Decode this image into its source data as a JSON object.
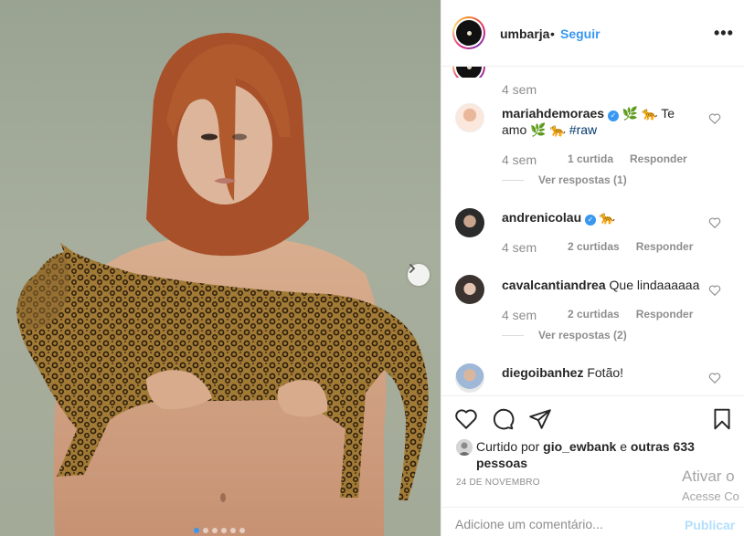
{
  "post": {
    "username": "umbarja",
    "separator": "•",
    "follow_label": "Seguir",
    "more_label": "•••",
    "carousel": {
      "total": 6,
      "active": 0
    }
  },
  "comments": {
    "top_time": "4 sem",
    "items": [
      {
        "username": "mariahdemoraes",
        "verified": true,
        "text": "🌿 🐆 Te amo 🌿 🐆",
        "hashtag": "#raw",
        "time": "4 sem",
        "likes": "1 curtida",
        "reply": "Responder",
        "view_replies": "Ver respostas (1)"
      },
      {
        "username": "andrenicolau",
        "verified": true,
        "text": "🐆",
        "time": "4 sem",
        "likes": "2 curtidas",
        "reply": "Responder"
      },
      {
        "username": "cavalcantiandrea",
        "verified": false,
        "text": "Que lindaaaaaa",
        "time": "4 sem",
        "likes": "2 curtidas",
        "reply": "Responder",
        "view_replies": "Ver respostas (2)"
      },
      {
        "username": "diegoibanhez",
        "verified": false,
        "text": "Fotão!"
      }
    ]
  },
  "liked": {
    "prefix": "Curtido por",
    "user": "gio_ewbank",
    "middle": "e",
    "others": "outras 633 pessoas"
  },
  "date": "24 DE NOVEMBRO",
  "add_comment": {
    "placeholder": "Adicione um comentário...",
    "publish_label": "Publicar"
  },
  "watermark": {
    "line1": "Ativar o",
    "line2": "Acesse Co"
  },
  "icons": {
    "next": "chevron-right-icon",
    "more": "more-horizontal-icon",
    "like": "heart-icon",
    "comment": "comment-bubble-icon",
    "share": "paper-plane-icon",
    "save": "bookmark-icon",
    "emoji": "smile-emoji-icon"
  },
  "colors": {
    "link_blue": "#3897f0",
    "hashtag": "#00376b",
    "muted": "#8e8e8e",
    "publish_disabled": "#b2dffc"
  }
}
